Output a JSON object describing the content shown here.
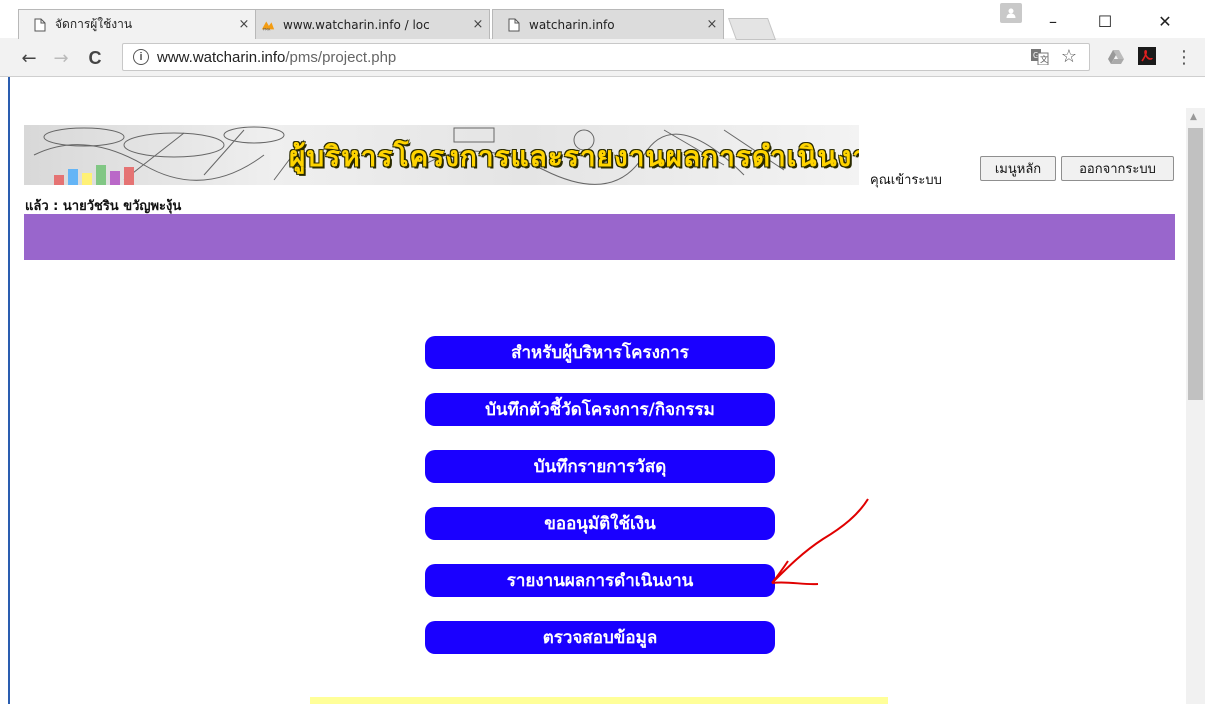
{
  "browser": {
    "tabs": [
      {
        "title": "จัดการผู้ใช้งาน",
        "close": "×",
        "icon": "page-icon"
      },
      {
        "title": "www.watcharin.info / loc",
        "close": "×",
        "icon": "pma-icon"
      },
      {
        "title": "watcharin.info",
        "close": "×",
        "icon": "page-icon"
      }
    ],
    "window": {
      "minimize": "–",
      "maximize": "☐",
      "close": "✕"
    },
    "nav": {
      "back": "←",
      "forward": "→",
      "reload": "C"
    },
    "url": {
      "host": "www.watcharin.info",
      "path": "/pms/project.php",
      "info": "i"
    },
    "toolbar_icons": [
      "translate-icon",
      "star-icon",
      "drive-icon",
      "pdf-icon",
      "menu-icon"
    ]
  },
  "header": {
    "banner_title": "ผู้บริหารโครงการและรายงานผลการดำเนินงาน",
    "login_prefix": "คุณเข้าระบบ",
    "login_user": "แล้ว : นายวัชริน ขวัญพะงุ้น",
    "main_menu_button": "เมนูหลัก",
    "logout_button": "ออกจากระบบ"
  },
  "menu": {
    "items": [
      "สำหรับผู้บริหารโครงการ",
      "บันทึกตัวชี้วัดโครงการ/กิจกรรม",
      "บันทึกรายการวัสดุ",
      "ขออนุมัติใช้เงิน",
      "รายงานผลการดำเนินงาน",
      "ตรวจสอบข้อมูล"
    ]
  },
  "colors": {
    "menu_button": "#1a00ff",
    "header_bar": "#9966cc",
    "annotation": "#e00000",
    "footer_bar": "#ffff99"
  }
}
